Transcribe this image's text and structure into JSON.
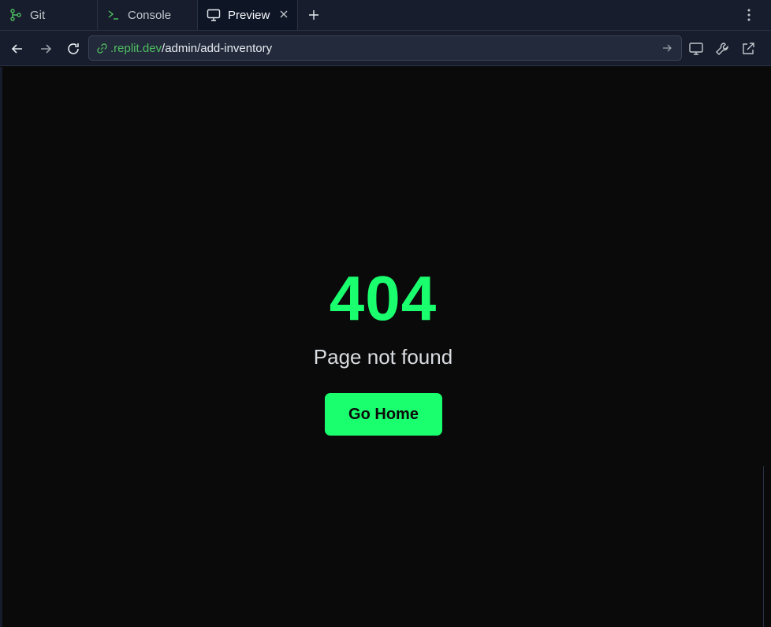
{
  "tabs": [
    {
      "label": "Git",
      "icon": "git-icon"
    },
    {
      "label": "Console",
      "icon": "terminal-icon"
    },
    {
      "label": "Preview",
      "icon": "monitor-icon",
      "active": true
    }
  ],
  "url": {
    "host": ".replit.dev",
    "path": "/admin/add-inventory"
  },
  "page": {
    "code": "404",
    "message": "Page not found",
    "button_label": "Go Home"
  },
  "colors": {
    "accent": "#1aff6e",
    "link_host": "#4ebf60",
    "chrome_bg": "#171d2d",
    "page_bg": "#0a0a0a"
  }
}
